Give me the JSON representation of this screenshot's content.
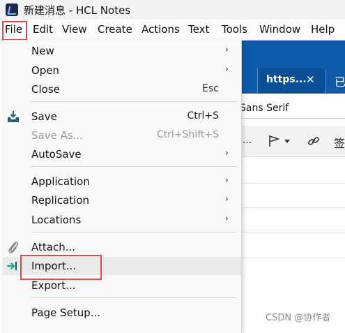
{
  "window": {
    "title": "新建消息 - HCL Notes"
  },
  "menubar": {
    "items": [
      "File",
      "Edit",
      "View",
      "Create",
      "Actions",
      "Text",
      "Tools",
      "Window",
      "Help"
    ]
  },
  "background": {
    "tab_label": "https...",
    "tab_close": "✕",
    "tab_next": "已",
    "font_name": "Sans Serif",
    "toolbar_fragment": "i...",
    "toolbar_sig": "签"
  },
  "file_menu": {
    "items": [
      {
        "label": "New",
        "submenu": true
      },
      {
        "label": "Open",
        "submenu": true
      },
      {
        "label": "Close",
        "shortcut": "Esc"
      },
      {
        "label": "Save",
        "shortcut": "Ctrl+S",
        "icon": "save-tray-icon"
      },
      {
        "label": "Save As...",
        "shortcut": "Ctrl+Shift+S",
        "disabled": true
      },
      {
        "label": "AutoSave",
        "submenu": true
      },
      {
        "label": "Application",
        "submenu": true
      },
      {
        "label": "Replication",
        "submenu": true
      },
      {
        "label": "Locations",
        "submenu": true
      },
      {
        "label": "Attach...",
        "icon": "paperclip-icon"
      },
      {
        "label": "Import...",
        "icon": "import-arrow-icon",
        "highlighted": true
      },
      {
        "label": "Export..."
      },
      {
        "label": "Page Setup..."
      }
    ],
    "arrow": "›"
  },
  "colors": {
    "accent_blue": "#0e5aa8",
    "highlight_red": "#e04a4a",
    "import_icon": "#1aa58a"
  },
  "watermark": "CSDN @协作者"
}
